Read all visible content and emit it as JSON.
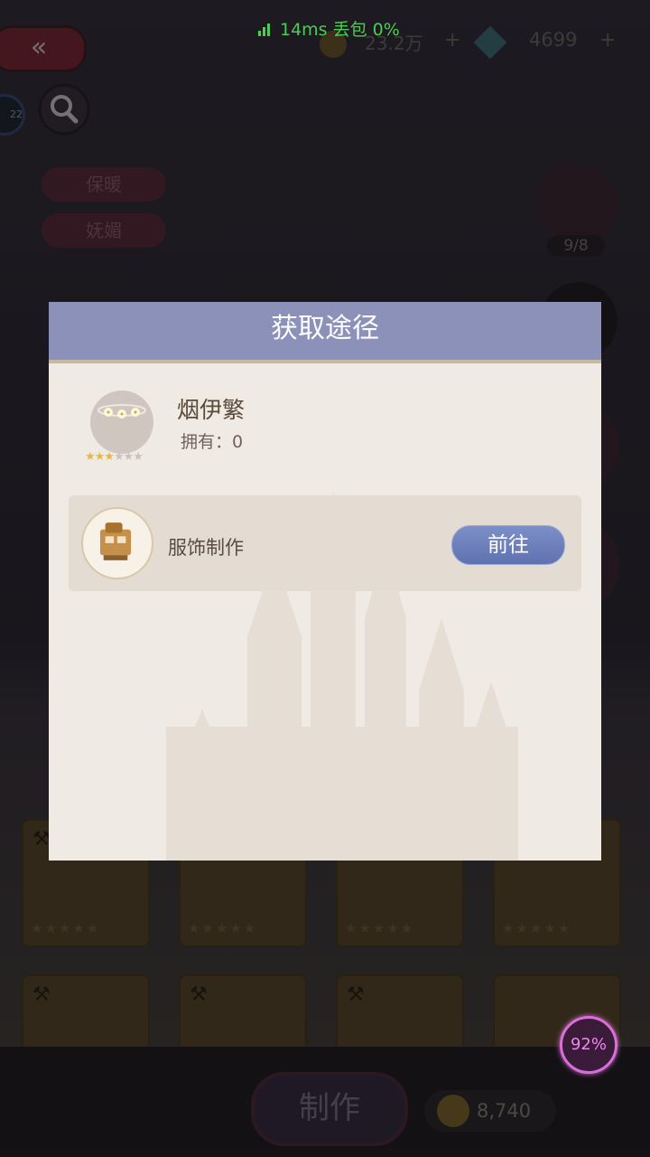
{
  "network": {
    "status_text": "14ms  丢包 0%"
  },
  "currency": {
    "gold": "23.2万",
    "gems": "4699",
    "plus": "+"
  },
  "tags": [
    "保暖",
    "妩媚"
  ],
  "side": {
    "count": "9/8"
  },
  "dialog": {
    "title": "获取途径",
    "item": {
      "name": "烟伊繁",
      "owned_label": "拥有：0",
      "stars_on": "★★★",
      "stars_off": "★★★"
    },
    "sources": [
      {
        "label": "服饰制作",
        "go_label": "前往"
      }
    ]
  },
  "bottom": {
    "make_label": "制作",
    "cost": "8,740"
  },
  "progress": {
    "label": "92%"
  },
  "colors": {
    "header": "#8c91b9",
    "dialog_bg": "#efebe4",
    "accent_button": "#6f80bd",
    "progress": "#d86ed8"
  }
}
